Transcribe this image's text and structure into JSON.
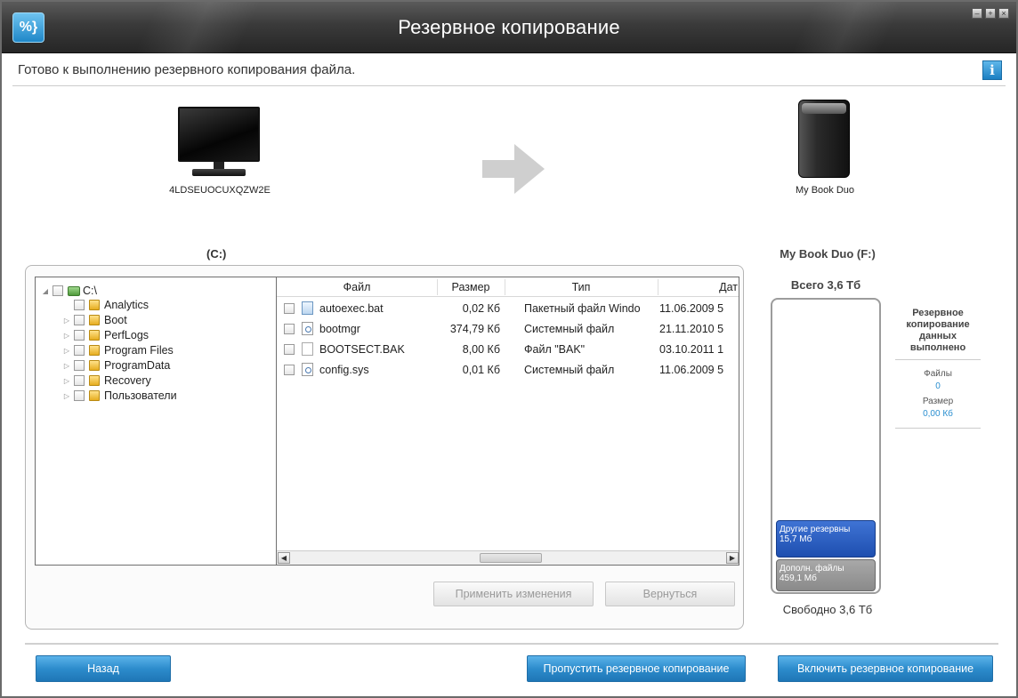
{
  "window": {
    "title": "Резервное копирование",
    "logo_glyph": "%}"
  },
  "status": {
    "message": "Готово к выполнению резервного копирования файла.",
    "info_glyph": "i"
  },
  "source": {
    "device_name": "4LDSEUOCUXQZW2E",
    "drive_label": "(C:)"
  },
  "target": {
    "device_name": "My Book Duo",
    "drive_label": "My Book Duo (F:)"
  },
  "tree": {
    "root": "C:\\",
    "items": [
      "Analytics",
      "Boot",
      "PerfLogs",
      "Program Files",
      "ProgramData",
      "Recovery",
      "Пользователи"
    ]
  },
  "files": {
    "columns": [
      "Файл",
      "Размер",
      "Тип",
      "Дат"
    ],
    "rows": [
      {
        "name": "autoexec.bat",
        "size": "0,02 Кб",
        "type": "Пакетный файл Windo",
        "date": "11.06.2009 5"
      },
      {
        "name": "bootmgr",
        "size": "374,79 Кб",
        "type": "Системный файл",
        "date": "21.11.2010 5"
      },
      {
        "name": "BOOTSECT.BAK",
        "size": "8,00 Кб",
        "type": "Файл \"BAK\"",
        "date": "03.10.2011 1"
      },
      {
        "name": "config.sys",
        "size": "0,01 Кб",
        "type": "Системный файл",
        "date": "11.06.2009 5"
      }
    ]
  },
  "panel_buttons": {
    "apply": "Применить изменения",
    "revert": "Вернуться"
  },
  "capacity": {
    "total": "Всего 3,6 Тб",
    "free": "Свободно 3,6 Тб",
    "other_backups_label": "Другие резервны",
    "other_backups_size": "15,7 Мб",
    "extra_files_label": "Дополн. файлы",
    "extra_files_size": "459,1 Мб"
  },
  "summary": {
    "heading": "Резервное копирование данных выполнено",
    "files_label": "Файлы",
    "files_value": "0",
    "size_label": "Размер",
    "size_value": "0,00 Кб"
  },
  "footer": {
    "back": "Назад",
    "skip": "Пропустить резервное копирование",
    "enable": "Включить резервное копирование"
  },
  "colors": {
    "accent": "#2d8ccc",
    "link": "#2b8fd0",
    "segment_other": "#1e4fb0",
    "segment_extra": "#8a8a8a"
  }
}
